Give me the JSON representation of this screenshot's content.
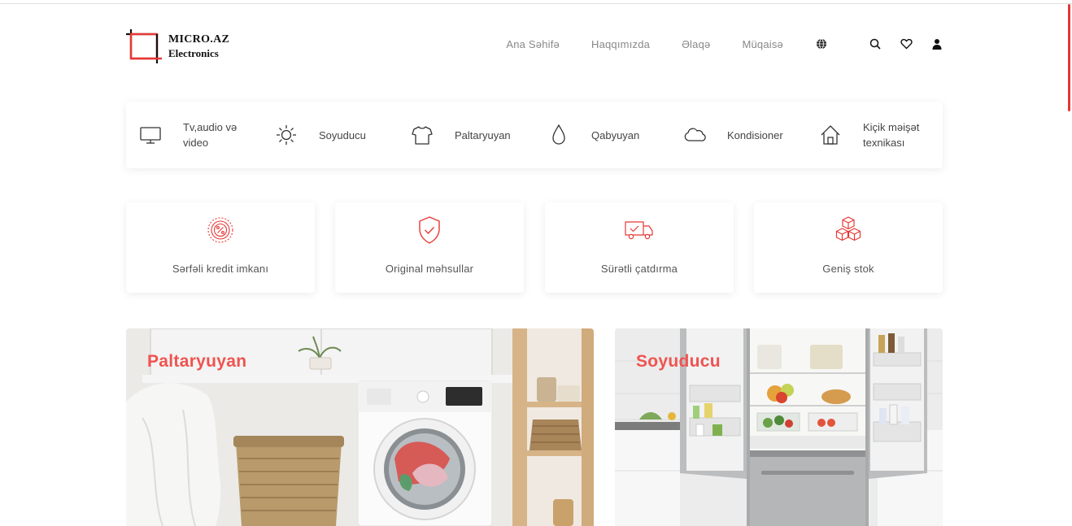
{
  "brand": {
    "line1": "MICRO.AZ",
    "line2": "Electronics",
    "accent": "#e53935"
  },
  "nav": {
    "links": [
      "Ana Səhifə",
      "Haqqımızda",
      "Əlaqə",
      "Müqaisə"
    ],
    "icons": [
      "globe-icon",
      "search-icon",
      "heart-icon",
      "user-icon"
    ]
  },
  "categories": [
    {
      "label": "Tv,audio və video",
      "icon": "tv-icon"
    },
    {
      "label": "Soyuducu",
      "icon": "sun-icon"
    },
    {
      "label": "Paltaryuyan",
      "icon": "shirt-icon"
    },
    {
      "label": "Qabyuyan",
      "icon": "drop-icon"
    },
    {
      "label": "Kondisioner",
      "icon": "cloud-icon"
    },
    {
      "label": "Kiçik məişət texnikası",
      "icon": "home-icon"
    }
  ],
  "features": [
    {
      "label": "Sərfəli kredit imkanı",
      "icon": "percent-badge-icon"
    },
    {
      "label": "Original məhsullar",
      "icon": "shield-check-icon"
    },
    {
      "label": "Sürətli çatdırma",
      "icon": "delivery-truck-icon"
    },
    {
      "label": "Geniş stok",
      "icon": "boxes-icon"
    }
  ],
  "banners": [
    {
      "title": "Paltaryuyan"
    },
    {
      "title": "Soyuducu"
    }
  ]
}
